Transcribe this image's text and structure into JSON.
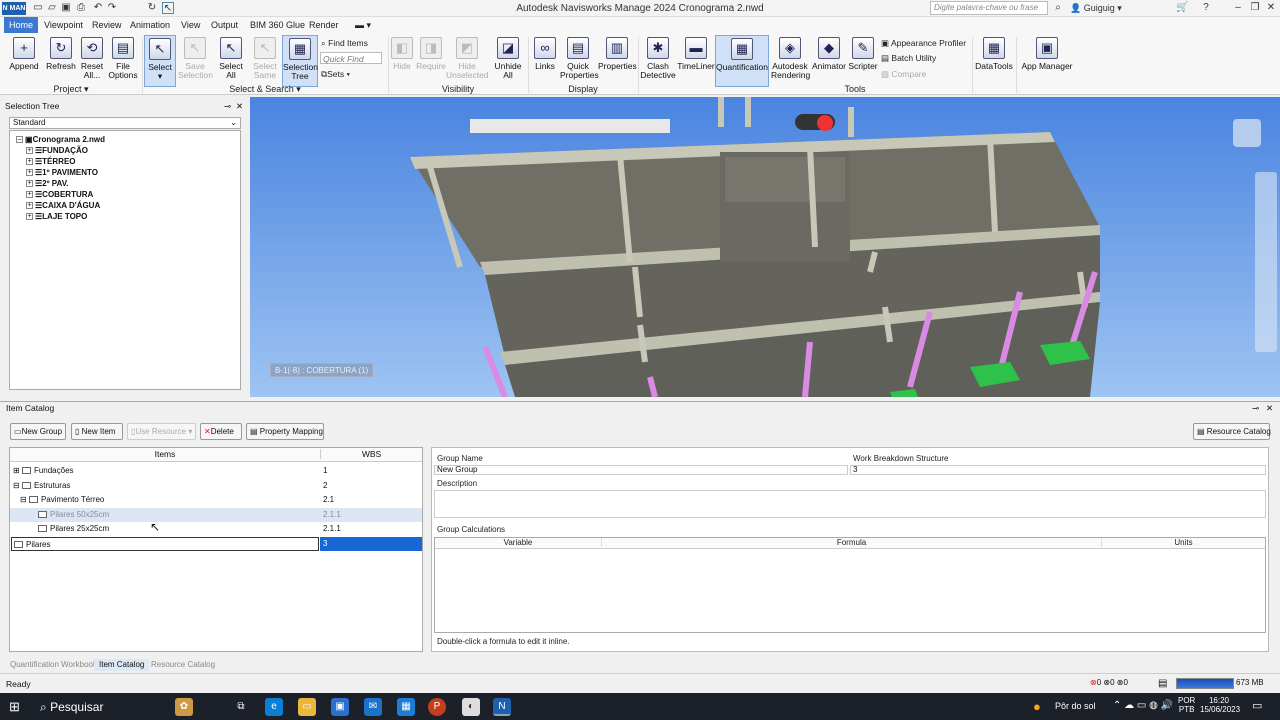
{
  "window": {
    "title": "Autodesk Navisworks Manage 2024   Cronograma 2.nwd",
    "search_placeholder": "Digite palavra-chave ou frase",
    "user": "Guiguig",
    "app_badge": "N MAN"
  },
  "tabs": [
    "Home",
    "Viewpoint",
    "Review",
    "Animation",
    "View",
    "Output",
    "BIM 360 Glue",
    "Render"
  ],
  "ribbon": {
    "project": {
      "append": "Append",
      "refresh": "Refresh",
      "reset": "Reset All...",
      "file_options": "File Options",
      "group": "Project ▾"
    },
    "select": {
      "select": "Select",
      "save_selection": "Save Selection",
      "select_all": "Select All",
      "select_same": "Select Same",
      "selection_tree": "Selection Tree",
      "find_items": "Find Items",
      "quick_find": "Quick Find",
      "sets": "Sets",
      "group": "Select & Search ▾"
    },
    "visibility": {
      "hide": "Hide",
      "require": "Require",
      "hide_unselected": "Hide Unselected",
      "unhide_all": "Unhide All",
      "group": "Visibility"
    },
    "display": {
      "links": "Links",
      "quick_properties": "Quick Properties",
      "properties": "Properties",
      "group": "Display"
    },
    "tools": {
      "clash_detective": "Clash Detective",
      "timeliner": "TimeLiner",
      "quantification": "Quantification",
      "autodesk_rendering": "Autodesk Rendering",
      "animator": "Animator",
      "scripter": "Scripter",
      "appearance_profiler": "Appearance Profiler",
      "batch_utility": "Batch Utility",
      "compare": "Compare",
      "datatools": "DataTools",
      "app_manager": "App Manager",
      "group": "Tools"
    }
  },
  "selection_tree": {
    "title": "Selection Tree",
    "mode": "Standard",
    "root": "Cronograma 2.nwd",
    "items": [
      "FUNDAÇÃO",
      "TÉRREO",
      "1º PAVIMENTO",
      "2º PAV.",
      "COBERTURA",
      "CAIXA D'ÁGUA",
      "LAJE TOPO"
    ]
  },
  "viewport": {
    "label": "B-1(-8) : COBERTURA (1)"
  },
  "item_catalog": {
    "title": "Item Catalog",
    "buttons": {
      "new_group": "New Group",
      "new_item": "New Item",
      "use_resource": "Use Resource",
      "delete": "Delete",
      "property_mapping": "Property Mapping",
      "resource_catalog": "Resource Catalog"
    },
    "columns": {
      "items": "Items",
      "wbs": "WBS"
    },
    "rows": [
      {
        "name": "Fundações",
        "wbs": "1"
      },
      {
        "name": "Estruturas",
        "wbs": "2"
      },
      {
        "name": "Pavimento Térreo",
        "wbs": "2.1"
      },
      {
        "name": "Pilares 50x25cm",
        "wbs": "2.1.1"
      },
      {
        "name": "Pilares 25x25cm",
        "wbs": "2.1.1"
      },
      {
        "name": "Pilares",
        "wbs": "3"
      }
    ],
    "details": {
      "group_name_label": "Group Name",
      "group_name": "New Group",
      "wbs_label": "Work Breakdown Structure",
      "wbs": "3",
      "description_label": "Description",
      "group_calculations_label": "Group Calculations",
      "calc_columns": [
        "Variable",
        "Formula",
        "Units"
      ],
      "hint": "Double-click a formula to edit it inline."
    }
  },
  "bottom_tabs": [
    "Quantification Workbook",
    "Item Catalog",
    "Resource Catalog"
  ],
  "status": {
    "ready": "Ready",
    "counts": [
      "0",
      "0",
      "0"
    ],
    "memory": "673 MB"
  },
  "taskbar": {
    "search": "Pesquisar",
    "weather": "Pôr do sol",
    "lang1": "POR",
    "lang2": "PTB",
    "time": "16:20",
    "date": "15/06/2023"
  }
}
